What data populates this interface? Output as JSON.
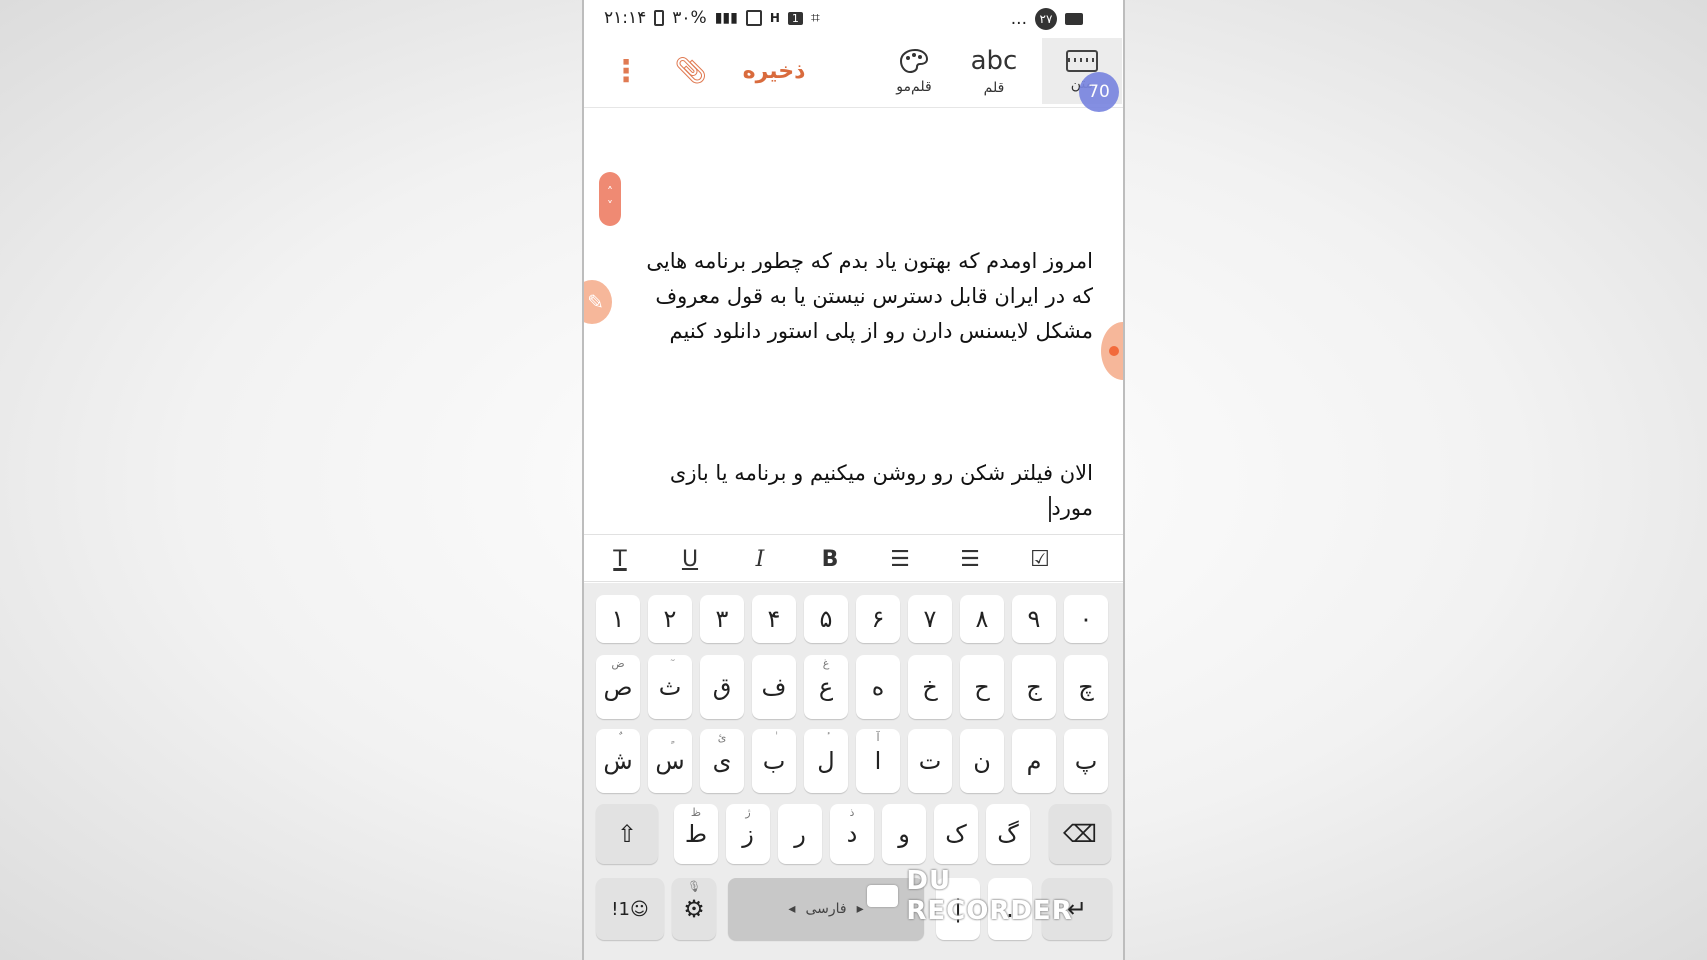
{
  "status_bar": {
    "time": "۲۱:۱۴",
    "battery": "۳۰%",
    "sim_badge": "1",
    "network_h": "H",
    "more": "...",
    "notification_count": "۲۷"
  },
  "toolbar": {
    "save_label": "ذخیره",
    "brush_label": "قلم‌مو",
    "pen_label": "قلم",
    "pen_glyph": "abc",
    "text_label": "متن",
    "page_counter": "70"
  },
  "note": {
    "paragraph1": "امروز اومدم که بهتون یاد بدم که چطور برنامه هایی که در ایران قابل دسترس نیستن یا به قول معروف مشکل لایسنس دارن رو از پلی استور دانلود کنیم",
    "paragraph2": "الان فیلتر شکن رو روشن میکنیم و برنامه یا بازی مورد"
  },
  "format_bar": {
    "items": [
      {
        "name": "text-style",
        "glyph": "T"
      },
      {
        "name": "underline",
        "glyph": "U"
      },
      {
        "name": "italic",
        "glyph": "I"
      },
      {
        "name": "bold",
        "glyph": "B"
      },
      {
        "name": "bullet-list",
        "glyph": "☰"
      },
      {
        "name": "numbered-list",
        "glyph": "☰"
      },
      {
        "name": "checklist",
        "glyph": "☑"
      }
    ]
  },
  "keyboard": {
    "row_numbers": [
      "۱",
      "۲",
      "۳",
      "۴",
      "۵",
      "۶",
      "۷",
      "۸",
      "۹",
      "۰"
    ],
    "row1": [
      {
        "k": "ص",
        "h": "ض"
      },
      {
        "k": "ث",
        "h": "ٓ"
      },
      {
        "k": "ق",
        "h": ""
      },
      {
        "k": "ف",
        "h": ""
      },
      {
        "k": "ع",
        "h": "غ"
      },
      {
        "k": "ه",
        "h": ""
      },
      {
        "k": "خ",
        "h": ""
      },
      {
        "k": "ح",
        "h": ""
      },
      {
        "k": "ج",
        "h": ""
      },
      {
        "k": "چ",
        "h": ""
      }
    ],
    "row2": [
      {
        "k": "ش",
        "h": "ٌ"
      },
      {
        "k": "س",
        "h": "ٍ"
      },
      {
        "k": "ی",
        "h": "ئ"
      },
      {
        "k": "ب",
        "h": "ٰ"
      },
      {
        "k": "ل",
        "h": "ٔ"
      },
      {
        "k": "ا",
        "h": "آ"
      },
      {
        "k": "ت",
        "h": ""
      },
      {
        "k": "ن",
        "h": ""
      },
      {
        "k": "م",
        "h": ""
      },
      {
        "k": "پ",
        "h": ""
      }
    ],
    "row3": [
      {
        "k": "ط",
        "h": "ظ"
      },
      {
        "k": "ز",
        "h": "ژ"
      },
      {
        "k": "ر",
        "h": ""
      },
      {
        "k": "د",
        "h": "ذ"
      },
      {
        "k": "و",
        "h": ""
      },
      {
        "k": "ک",
        "h": ""
      },
      {
        "k": "گ",
        "h": ""
      }
    ],
    "shift": "⇧",
    "backspace": "⌫",
    "symbols_key": "!1☺",
    "settings_key": "⚙",
    "space_label": "فارسی",
    "space_left_arrow": "◂",
    "space_right_arrow": "▸",
    "zwnj_key": "‌|",
    "period_key": ".",
    "enter_key": "↵"
  },
  "watermark": "DU RECORDER"
}
